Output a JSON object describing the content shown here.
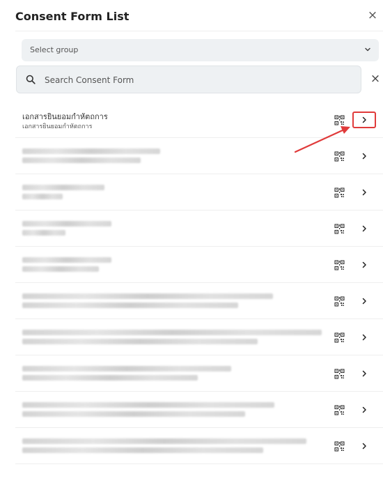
{
  "header": {
    "title": "Consent Form List",
    "close_glyph": "×"
  },
  "filters": {
    "group_select": {
      "value": "Select group"
    },
    "search": {
      "placeholder": "Search Consent Form",
      "value": "",
      "clear_glyph": "×"
    }
  },
  "rows": [
    {
      "name": "เอกสารยินยอมกำหัตถการ",
      "subtitle": "เอกสารยินยอมกำหัตถการ",
      "redacted": false,
      "highlighted": true
    },
    {
      "redacted": true,
      "highlighted": false
    },
    {
      "redacted": true,
      "highlighted": false
    },
    {
      "redacted": true,
      "highlighted": false
    },
    {
      "redacted": true,
      "highlighted": false
    },
    {
      "redacted": true,
      "highlighted": false
    },
    {
      "redacted": true,
      "highlighted": false
    },
    {
      "redacted": true,
      "highlighted": false
    },
    {
      "redacted": true,
      "highlighted": false
    },
    {
      "redacted": true,
      "highlighted": false
    }
  ],
  "icons": {
    "close": "close-icon",
    "dropdown": "chevron-down-icon",
    "search": "search-icon",
    "qr": "qr-code-icon",
    "arrow": "chevron-right-icon"
  },
  "colors": {
    "highlight": "#e03a3a",
    "field_bg": "#eef1f3",
    "divider": "#eeeeee"
  }
}
